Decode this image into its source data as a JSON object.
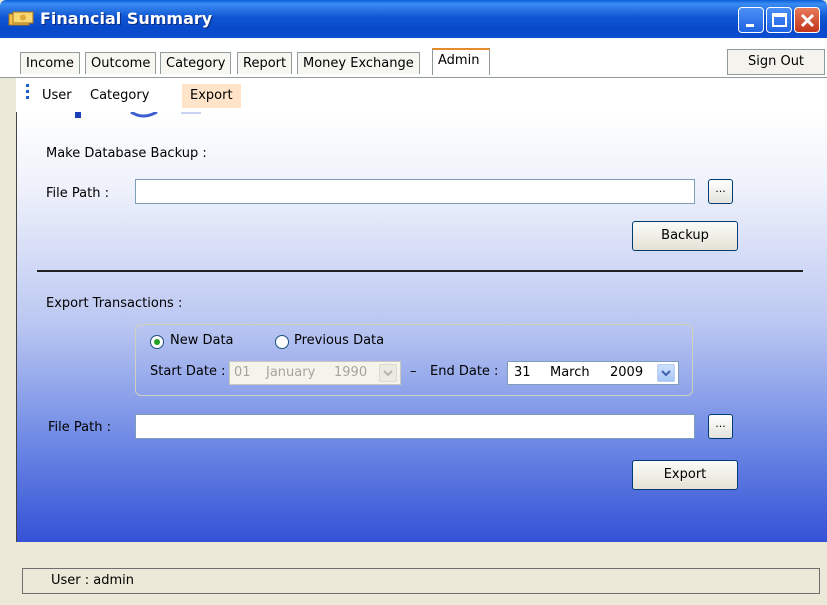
{
  "window": {
    "title": "Financial Summary",
    "icon": "money-icon",
    "accent": "#0a5fd8"
  },
  "tabs": [
    {
      "label": "Income"
    },
    {
      "label": "Outcome"
    },
    {
      "label": "Category"
    },
    {
      "label": "Report"
    },
    {
      "label": "Money Exchange"
    },
    {
      "label": "Admin",
      "active": true
    }
  ],
  "signout_label": "Sign Out",
  "menu": [
    {
      "label": "User"
    },
    {
      "label": "Category"
    },
    {
      "label": "Export",
      "highlighted": true
    }
  ],
  "backup": {
    "heading": "Make Database Backup :",
    "file_path_label": "File Path :",
    "file_path_value": "",
    "browse_label": "...",
    "button_label": "Backup"
  },
  "export": {
    "heading": "Export Transactions :",
    "radio_new": "New Data",
    "radio_previous": "Previous Data",
    "selected": "New Data",
    "start_label": "Start Date :",
    "start_date": {
      "day": "01",
      "month": "January",
      "year": "1990",
      "enabled": false
    },
    "dash": "–",
    "end_label": "End Date :",
    "end_date": {
      "day": "31",
      "month": "March",
      "year": "2009",
      "enabled": true
    },
    "file_path_label": "File Path :",
    "file_path_value": "",
    "browse_label": "...",
    "button_label": "Export"
  },
  "status": {
    "text": "User :  admin"
  }
}
